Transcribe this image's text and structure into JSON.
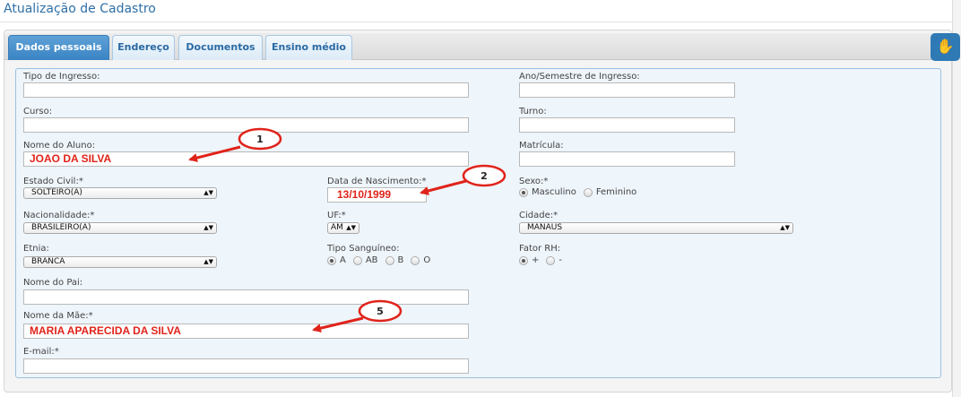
{
  "page": {
    "title": "Atualização de Cadastro"
  },
  "tabs": [
    {
      "label": "Dados pessoais",
      "active": true
    },
    {
      "label": "Endereço",
      "active": false
    },
    {
      "label": "Documentos",
      "active": false
    },
    {
      "label": "Ensino médio",
      "active": false
    }
  ],
  "accessibility": {
    "icon": "sign-language-icon"
  },
  "form": {
    "tipo_ingresso": {
      "label": "Tipo de Ingresso:",
      "value": ""
    },
    "ano_semestre": {
      "label": "Ano/Semestre de Ingresso:",
      "value": ""
    },
    "curso": {
      "label": "Curso:",
      "value": ""
    },
    "turno": {
      "label": "Turno:",
      "value": ""
    },
    "nome_aluno": {
      "label": "Nome do Aluno:",
      "value": "JOAO DA SILVA"
    },
    "matricula": {
      "label": "Matrícula:",
      "value": ""
    },
    "estado_civil": {
      "label": "Estado Civil:*",
      "value": "SOLTEIRO(A)"
    },
    "data_nascimento": {
      "label": "Data de Nascimento:*",
      "value": "13/10/1999"
    },
    "sexo": {
      "label": "Sexo:*",
      "options": [
        "Masculino",
        "Feminino"
      ],
      "selected": "Masculino"
    },
    "nacionalidade": {
      "label": "Nacionalidade:*",
      "value": "BRASILEIRO(A)"
    },
    "uf": {
      "label": "UF:*",
      "value": "AM"
    },
    "cidade": {
      "label": "Cidade:*",
      "value": "MANAUS"
    },
    "etnia": {
      "label": "Etnia:",
      "value": "BRANCA"
    },
    "tipo_sanguineo": {
      "label": "Tipo Sanguíneo:",
      "options": [
        "A",
        "AB",
        "B",
        "O"
      ],
      "selected": "A"
    },
    "fator_rh": {
      "label": "Fator RH:",
      "options": [
        "+",
        "-"
      ],
      "selected": "+"
    },
    "nome_pai": {
      "label": "Nome do Pai:",
      "value": ""
    },
    "nome_mae": {
      "label": "Nome da Mãe:*",
      "value": "MARIA APARECIDA DA SILVA"
    },
    "email": {
      "label": "E-mail:*",
      "value": ""
    }
  },
  "callouts": {
    "c1": "1",
    "c2": "2",
    "c5": "5"
  },
  "colors": {
    "accent": "#3a84c4",
    "annotation": "#e0231a"
  }
}
